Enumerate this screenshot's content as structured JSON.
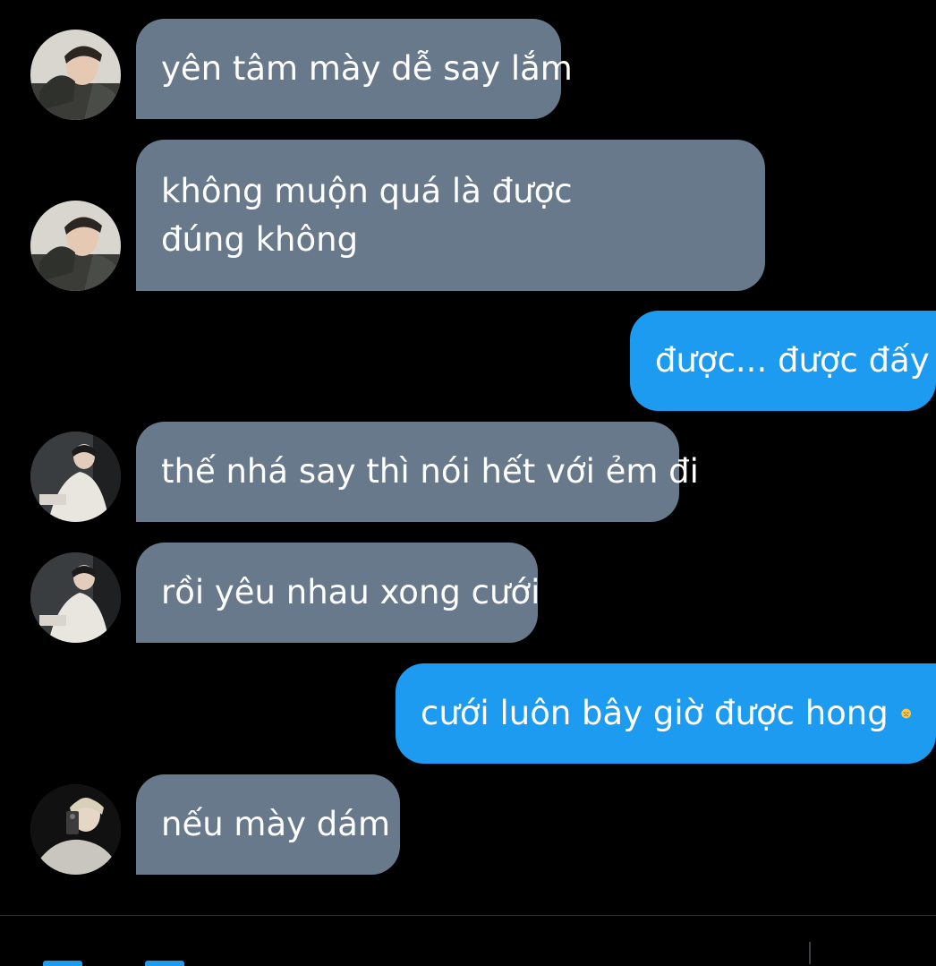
{
  "conversation": {
    "messages": [
      {
        "direction": "incoming",
        "avatar": "avatar-1",
        "text": "yên tâm mày dễ say lắm"
      },
      {
        "direction": "incoming",
        "avatar": "avatar-1",
        "text": "không muộn quá là được đúng không"
      },
      {
        "direction": "outgoing",
        "text": "được... được đấy"
      },
      {
        "direction": "incoming",
        "avatar": "avatar-2",
        "text": "thế nhá say thì nói hết với ẻm đi"
      },
      {
        "direction": "incoming",
        "avatar": "avatar-2",
        "text": "rồi yêu nhau xong cưới"
      },
      {
        "direction": "outgoing",
        "text": "cưới luôn bây giờ được hong",
        "emoji": "disappointed-face-icon"
      },
      {
        "direction": "incoming",
        "avatar": "avatar-3",
        "text": "nếu mày dám"
      }
    ]
  },
  "colors": {
    "background": "#000000",
    "incoming_bubble": "#67798a",
    "outgoing_bubble": "#1d9bf0",
    "text": "#ffffff",
    "divider": "#2f3336"
  }
}
